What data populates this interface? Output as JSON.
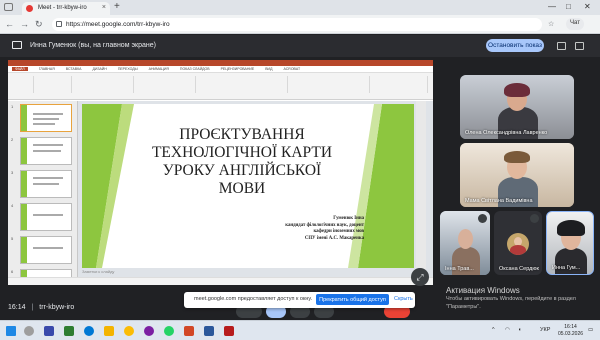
{
  "browser": {
    "tab_title": "Meet - trr-kbyw-iro",
    "tab_close": "×",
    "new_tab": "+",
    "url": "https://meet.google.com/trr-kbyw-iro",
    "chat_label": "Чат",
    "win_min": "—",
    "win_max": "□",
    "win_close": "✕",
    "nav_back": "←",
    "nav_forward": "→",
    "nav_reload": "↻"
  },
  "meet": {
    "presenter_text": "Инна Гуменюк (вы, на главном экране)",
    "stop_showing": "Остановить показ",
    "meeting_time": "16:14",
    "meeting_code": "trr-kbyw-iro",
    "expand_icon": "⤢"
  },
  "powerpoint": {
    "menu": [
      "ФАЙЛ",
      "ГЛАВНАЯ",
      "ВСТАВКА",
      "ДИЗАЙН",
      "ПЕРЕХОДЫ",
      "АНИМАЦИЯ",
      "ПОКАЗ СЛАЙДОВ",
      "РЕЦЕНЗИРОВАНИЕ",
      "ВИД",
      "ACROBAT"
    ],
    "thumbnail_numbers": [
      "1",
      "2",
      "3",
      "4",
      "5",
      "6",
      "7"
    ],
    "slide_title": "ПРОЄКТУВАННЯ ТЕХНОЛОГІЧНОЇ КАРТИ УРОКУ АНГЛІЙСЬКОЇ МОВИ",
    "author_lines": [
      "Гуменюк Інна",
      "кандидат філологічних наук, доцент",
      "кафедри іноземних мов",
      "СПУ імені А.С. Макаренка"
    ],
    "notes_placeholder": "Заметки к слайду"
  },
  "participants": [
    {
      "name": "Олена Олександрівна Лавренко"
    },
    {
      "name": "Мама Світлана Вадимівна"
    },
    {
      "name": "Інна Трав..."
    },
    {
      "name": "Оксана Сердюк"
    },
    {
      "name": "Инна Гум..."
    }
  ],
  "share_notification": {
    "text": "meet.google.com предоставляет доступ к окну.",
    "stop_button": "Прекратить общий доступ",
    "hide_button": "Скрыть"
  },
  "windows_activation": {
    "title": "Активация Windows",
    "line1": "Чтобы активировать Windows, перейдите в раздел",
    "line2": "\"Параметры\"."
  },
  "taskbar": {
    "language": "УКР",
    "time": "16:14",
    "date": "05.03.2026",
    "tray_up": "^"
  },
  "colors": {
    "accent_blue": "#a8c7fa",
    "pp_red": "#b7472a",
    "slide_green": "#8dc63f"
  }
}
